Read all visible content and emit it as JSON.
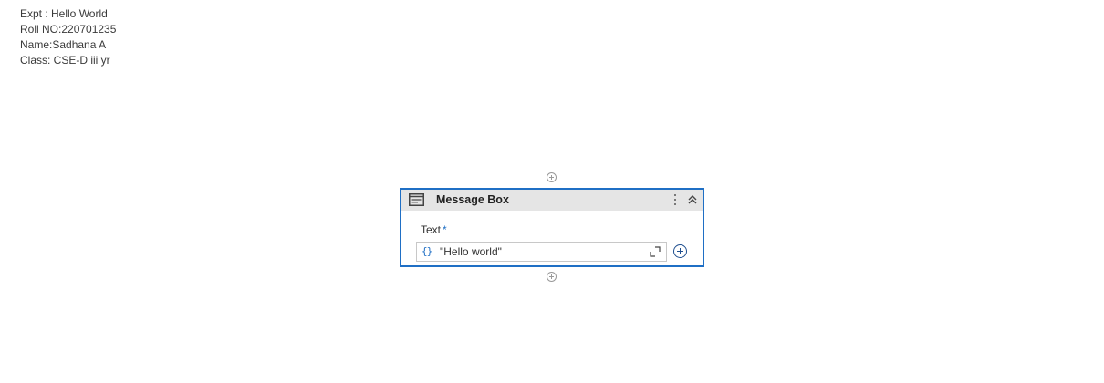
{
  "notes": {
    "expt": "Expt : Hello World",
    "roll": "Roll NO:220701235",
    "name": "Name:Sadhana A",
    "class": "Class: CSE-D iii yr"
  },
  "activity": {
    "title": "Message Box",
    "icon": "message-box-icon",
    "field_label": "Text",
    "required_marker": "*",
    "expression_icon": "{}",
    "value": "\"Hello world\""
  },
  "colors": {
    "accent": "#1f6fc5",
    "header_bg": "#e5e5e5"
  }
}
